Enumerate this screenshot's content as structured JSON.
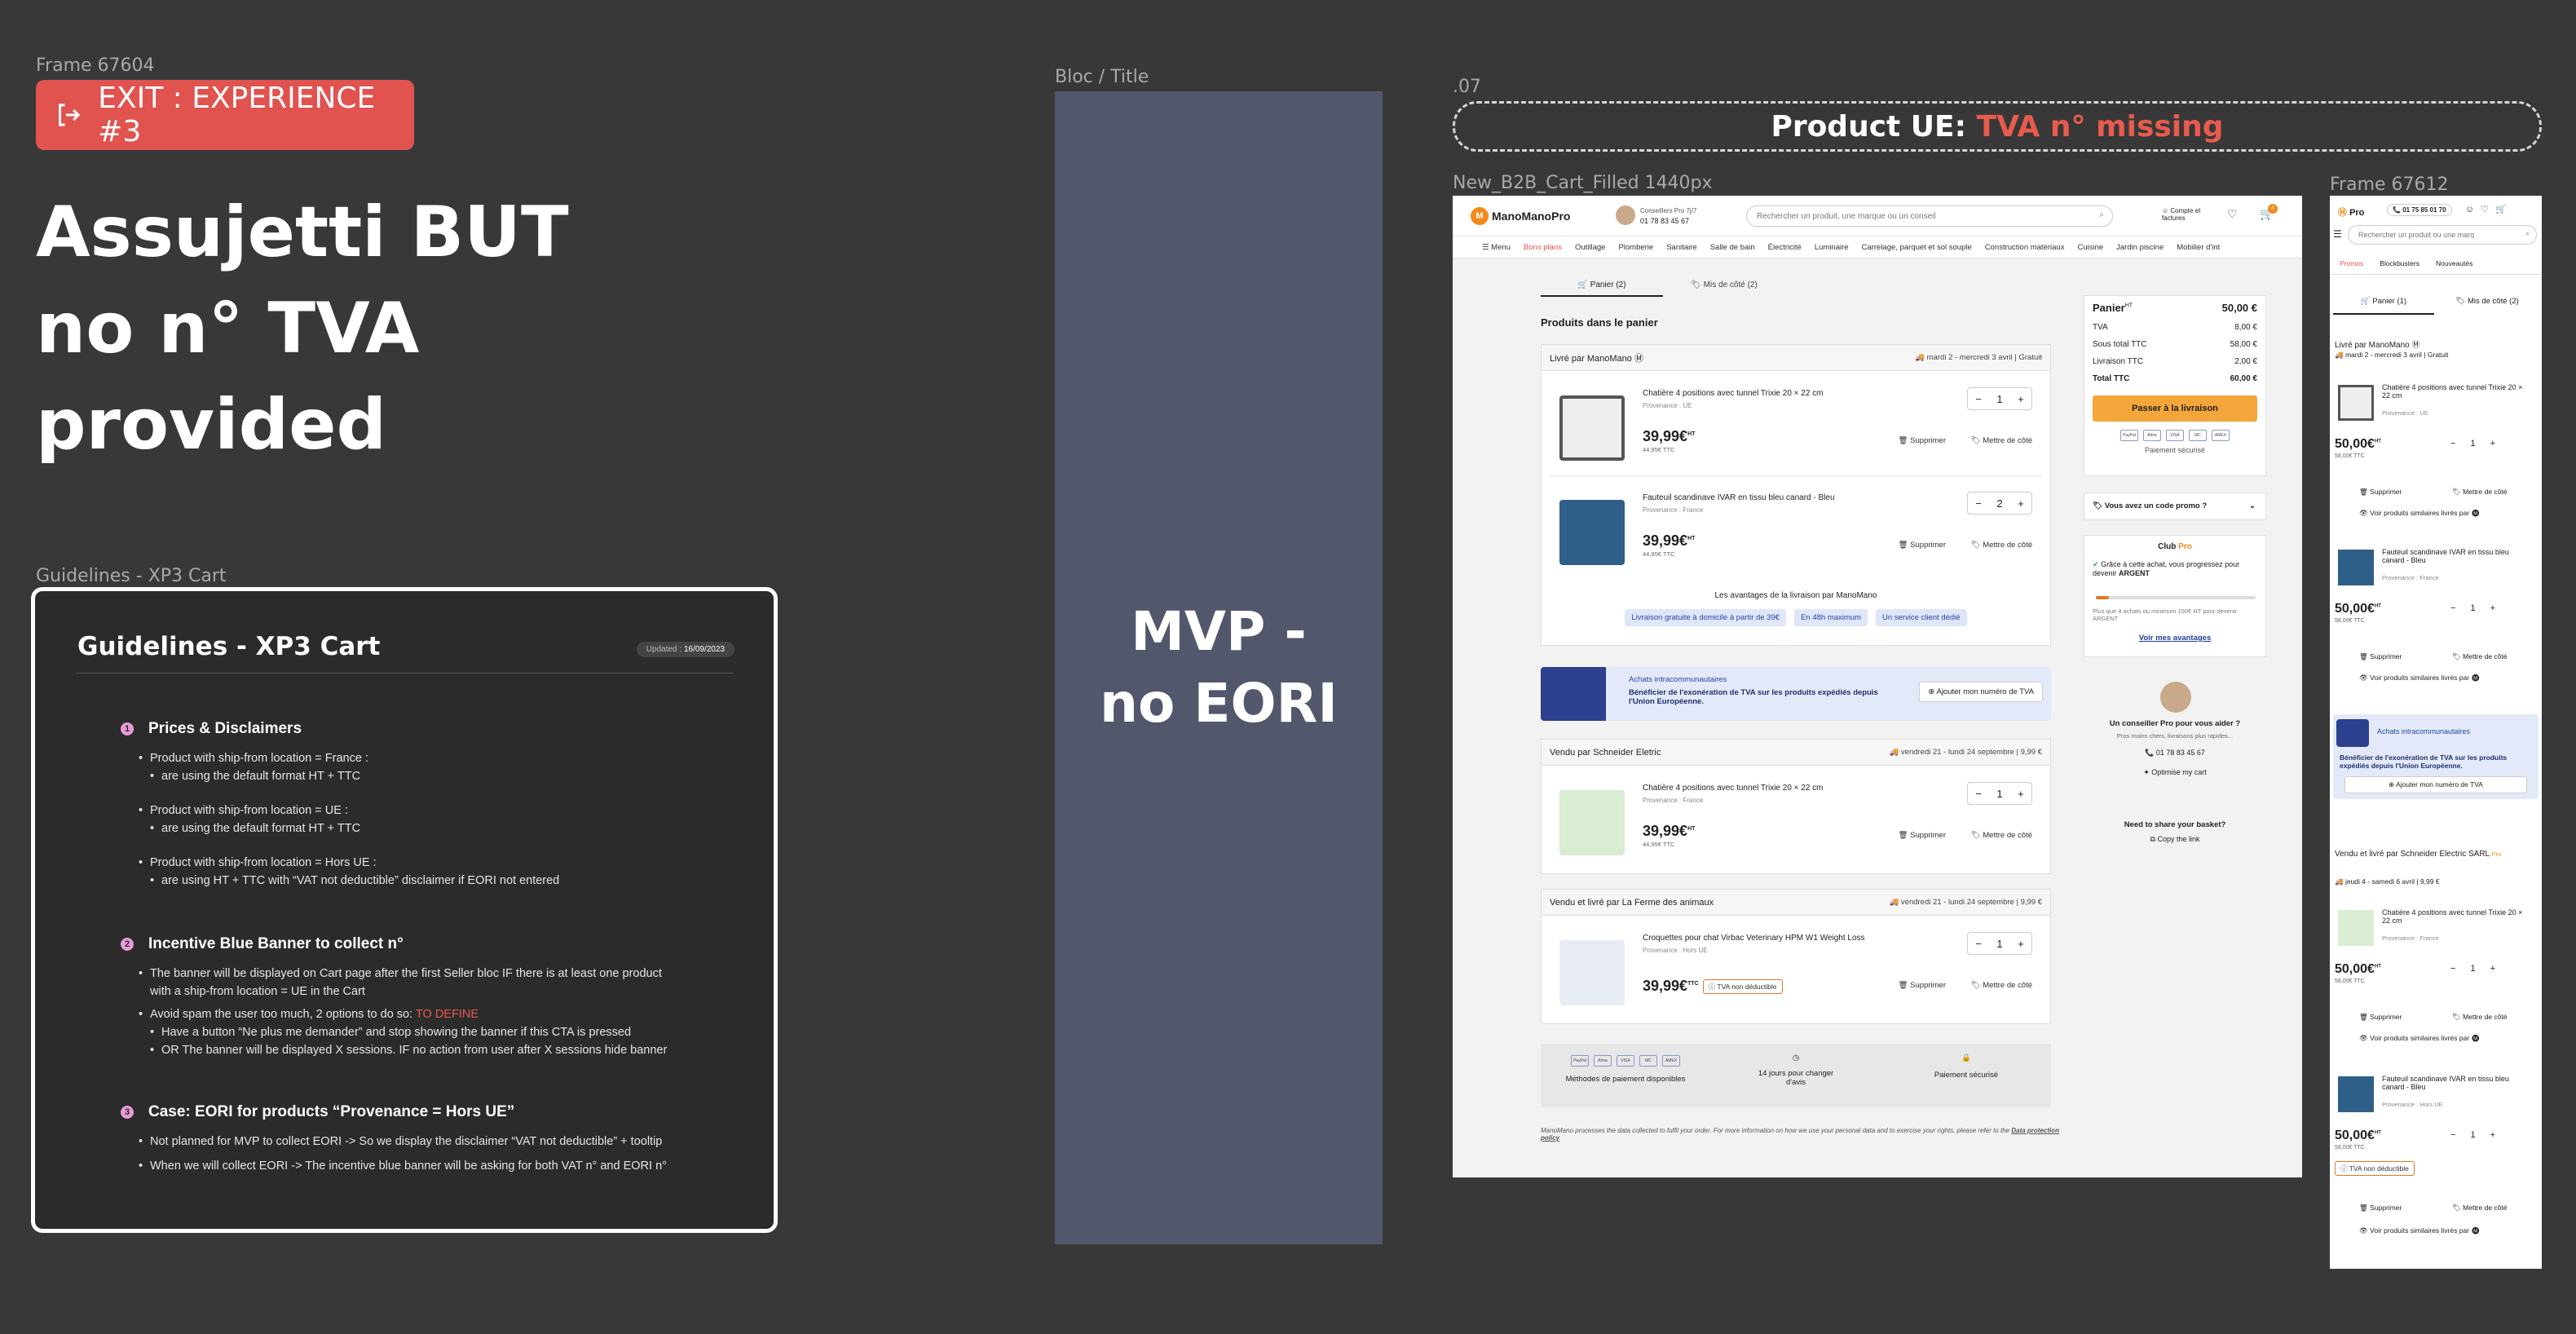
{
  "left": {
    "frame_label": "Frame 67604",
    "exit_label": "EXIT : EXPERIENCE #3",
    "headline": [
      "Assujetti BUT",
      "no n° TVA",
      "provided"
    ],
    "guide_frame_label": "Guidelines - XP3 Cart",
    "guide": {
      "title": "Guidelines - XP3 Cart",
      "updated_label": "Updated :",
      "updated_date": "16/09/2023",
      "s1_num": "1",
      "s1_title": "Prices & Disclaimers",
      "s1_items": [
        "Product with ship-from location = France :",
        "are using the default format HT + TTC",
        "Product with ship-from location = UE :",
        "are using the default format HT + TTC",
        "Product with ship-from location = Hors UE :",
        "are using HT + TTC with “VAT not deductible” disclaimer if EORI not entered"
      ],
      "s2_num": "2",
      "s2_title": "Incentive Blue Banner to collect n°",
      "s2_items": [
        "The banner will be displayed on Cart page after the first Seller bloc IF there is at least one product",
        "with a ship-from location = UE in the Cart",
        "Avoid spam the user too much, 2 options to do so:",
        "TO DEFINE",
        "Have a button “Ne plus me demander” and stop showing the banner if this CTA is pressed",
        "OR The banner will be displayed X sessions. IF no action from user after X sessions hide banner"
      ],
      "s3_num": "3",
      "s3_title": "Case: EORI for products “Provenance = Hors UE”",
      "s3_items": [
        "Not planned for MVP to collect EORI -> So we display the disclaimer “VAT not deductible” + tooltip",
        "When we will collect EORI -> The incentive blue banner will be asking for both VAT n° and EORI n°"
      ]
    }
  },
  "middle": {
    "frame_label": "Bloc / Title",
    "title": [
      "MVP -",
      "no EORI"
    ]
  },
  "right": {
    "step_label": ".07",
    "banner_prefix": "Product UE:",
    "banner_highlight": "TVA n° missing",
    "desktop_label": "New_B2B_Cart_Filled 1440px",
    "mobile_label": "Frame 67612"
  },
  "colors": {
    "accent_red": "#e85b4e",
    "brand_orange": "#f28a1a",
    "button_orange": "#f3a63a",
    "bloc": "#53576c"
  },
  "desktop": {
    "logo": "ManoManoPro",
    "advisor_title": "Conseillers Pro 7j/7",
    "advisor_phone": "01 78 83 45 67",
    "search_placeholder": "Rechercher un produit, une marque ou un conseil",
    "account": "Compte et factures",
    "cart_count": "4",
    "nav": [
      "Menu",
      "Bons plans",
      "Outillage",
      "Plomberie",
      "Sanitaire",
      "Salle de bain",
      "Électricité",
      "Luminaire",
      "Carrelage, parquet et sol souple",
      "Construction matériaux",
      "Cuisine",
      "Jardin piscine",
      "Mobilier d'int"
    ],
    "tab_cart": "Panier (2)",
    "tab_saved": "Mis de côté (2)",
    "section_title": "Produits dans le panier",
    "seller1": "Livré par ManoMano",
    "seller1_delivery": "mardi 2 - mercredi 3 avril",
    "seller1_fee": "Gratuit",
    "p1_name": "Chatière 4 positions avec tunnel Trixie 20 × 22 cm",
    "p1_prov": "Provenance : UE",
    "p1_qty": "1",
    "p2_name": "Fauteuil scandinave IVAR en tissu bleu canard - Bleu",
    "p2_prov": "Provenance : France",
    "p2_qty": "2",
    "price_ht": "39,99€",
    "price_ht_sup": "HT",
    "price_ttc": "44,95€ TTC",
    "remove": "Supprimer",
    "save": "Mettre de côté",
    "advantages_title": "Les avantages de la livraison par ManoMano",
    "advantages": [
      "Livraison gratuite à domicile à partir de 39€",
      "En 48h maximum",
      "Un service client dédié"
    ],
    "banner_title": "Achats intracommunautaires",
    "banner_text": "Bénéficier de l'exonération de TVA sur les produits expédiés depuis l'Union Européenne.",
    "banner_btn": "Ajouter mon numéro de TVA",
    "seller2": "Vendu par Schneider Eletric",
    "seller2_delivery": "vendredi 21 - lundi 24 septembre",
    "seller2_fee": "9,99 €",
    "p3_name": "Chatière 4 positions avec tunnel Trixie 20 × 22 cm",
    "p3_prov": "Provenance : France",
    "p3_qty": "1",
    "seller3": "Vendu et livré par La Ferme des animaux",
    "seller3_delivery": "vendredi 21 - lundi 24 septembre",
    "seller3_fee": "9,99 €",
    "p4_name": "Croquettes pour chat Virbac Veterinary HPM W1 Weight Loss",
    "p4_prov": "Provenance : Hors UE",
    "p4_qty": "1",
    "price_ttc_sup": "TTC",
    "tva_badge": "TVA non déductible",
    "footer_pay": "Méthodes de paiement disponibles",
    "footer_days": "14 jours pour changer d'avis",
    "footer_secure": "Paiement sécurisé",
    "legal": "ManoMano processes the data collected to fulfil your order. For more information on how we use your personal data and to exercise your rights, please refer to the",
    "legal_link": "Data protection policy",
    "sum_title": "Panier",
    "sum_title_sup": "HT",
    "sum_total_ht": "50,00 €",
    "sum_rows": [
      [
        "TVA",
        "8,00 €"
      ],
      [
        "Sous total TTC",
        "58,00 €"
      ],
      [
        "Livraison TTC",
        "2,00 €"
      ],
      [
        "Total TTC",
        "60,00 €"
      ]
    ],
    "sum_btn": "Passer à la livraison",
    "pay_methods": [
      "PayPal",
      "Alma",
      "VISA",
      "MC",
      "AMEX"
    ],
    "secure": "Paiement sécurisé",
    "promo": "Vous avez un code promo ?",
    "club_title": "Club",
    "club_pro": "Pro",
    "club_text": "Grâce à cette achat, vous progressez pour devenir",
    "club_level": "ARGENT",
    "club_sub": "Plus que 4 achats ou minimum 150€ HT pour devenir ARGENT",
    "club_link": "Voir mes avantages",
    "advisor_help": "Un conseiller Pro pour vous aider ?",
    "advisor_sub": "Pros moins chers, livraisons plus rapides...",
    "advisor_num": "01 78 83 45 67",
    "optimise": "Optimise my cart",
    "share_title": "Need to share your basket?",
    "share_link": "Copy the link"
  },
  "mobile": {
    "logo": "Pro",
    "phone": "01 75 85 01 70",
    "search": "Rechercher un produit ou une marq",
    "nav": [
      "Promos",
      "Blockbusters",
      "Nouveautés"
    ],
    "tab_cart": "Panier (1)",
    "tab_saved": "Mis de côté (2)",
    "seller1": "Livré par ManoMano",
    "seller1_delivery": "mardi 2 - mercredi 3 avril",
    "seller1_fee": "Gratuit",
    "p1": "Chatière 4 positions avec tunnel Trixie 20 × 22 cm",
    "p1_prov": "Provenance : UE",
    "p2": "Fauteuil scandinave IVAR en tissu bleu canard - Bleu",
    "p2_prov": "Provenance : France",
    "p3": "Chatière 4 positions avec tunnel Trixie 20 × 22 cm",
    "p3_prov": "Provenance : France",
    "p4": "Fauteuil scandinave IVAR en tissu bleu canard - Bleu",
    "p4_prov": "Provenance : Hors UE",
    "price": "50,00€",
    "price_sup": "HT",
    "price_ttc": "58,00€ TTC",
    "qty": "1",
    "remove": "Supprimer",
    "save": "Mettre de côté",
    "similar": "Voir produits similaires livrés par",
    "banner_title": "Achats intracommunautaires",
    "banner_text": "Bénéficier de l'exonération de TVA sur les produits expédiés depuis l'Union Européenne.",
    "banner_btn": "Ajouter mon numéro de TVA",
    "seller2": "Vendu et livré par Schneider Electric SARL",
    "seller2_pro": "Pro",
    "seller2_delivery": "jeudi 4 - samedi 6 avril",
    "seller2_fee": "9,99 €",
    "tva_badge": "TVA non déductible"
  }
}
